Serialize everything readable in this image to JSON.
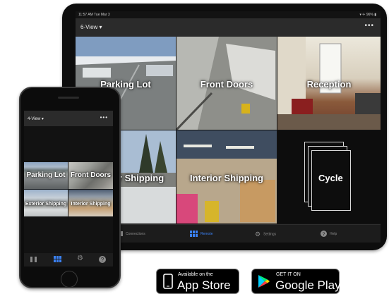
{
  "tablet": {
    "status_time": "11:57 AM   Tue Mar 3",
    "status_right": "▾ ✈ 96% ▮",
    "view_title": "6-View",
    "more_label": "•••",
    "cameras": [
      "Parking Lot",
      "Front Doors",
      "Reception",
      "Exterior Shipping",
      "Interior Shipping"
    ],
    "cycle_label": "Cycle",
    "tabs": [
      {
        "label": "Connections",
        "icon": "connections-icon"
      },
      {
        "label": "Remote",
        "icon": "remote-grid-icon"
      },
      {
        "label": "Settings",
        "icon": "gear-icon"
      },
      {
        "label": "Help",
        "icon": "help-icon"
      }
    ],
    "active_tab": "Remote",
    "accent": "#3b82f6"
  },
  "phone": {
    "view_title": "4-View",
    "more_label": "•••",
    "cameras": [
      "Parking Lot",
      "Front Doors",
      "Exterior Shipping",
      "Interior Shipping"
    ],
    "tab_icons": [
      "connections-icon",
      "remote-grid-icon",
      "gear-icon",
      "help-icon"
    ]
  },
  "badges": {
    "apple": {
      "small": "Available on the",
      "big": "App Store"
    },
    "google": {
      "small": "GET IT ON",
      "big": "Google Play"
    }
  }
}
